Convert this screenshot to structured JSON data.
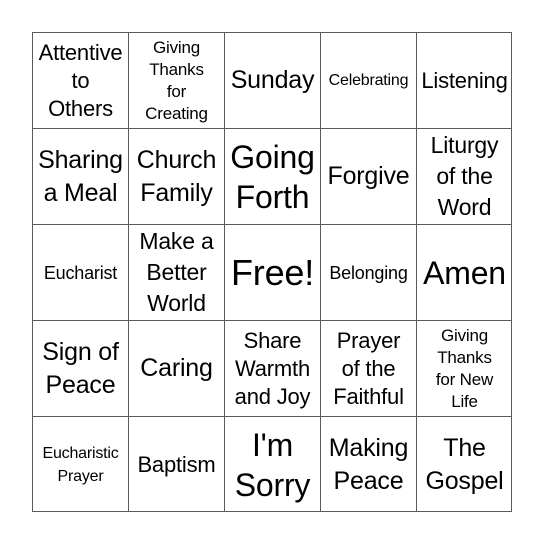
{
  "board": {
    "cells": [
      [
        "Attentive\nto\nOthers",
        "Giving\nThanks\nfor\nCreating",
        "Sunday",
        "Celebrating",
        "Listening"
      ],
      [
        "Sharing\na Meal",
        "Church\nFamily",
        "Going\nForth",
        "Forgive",
        "Liturgy\nof the\nWord"
      ],
      [
        "Eucharist",
        "Make a\nBetter\nWorld",
        "Free!",
        "Belonging",
        "Amen"
      ],
      [
        "Sign of\nPeace",
        "Caring",
        "Share\nWarmth\nand Joy",
        "Prayer\nof the\nFaithful",
        "Giving\nThanks\nfor New\nLife"
      ],
      [
        "Eucharistic\nPrayer",
        "Baptism",
        "I'm\nSorry",
        "Making\nPeace",
        "The\nGospel"
      ]
    ]
  }
}
